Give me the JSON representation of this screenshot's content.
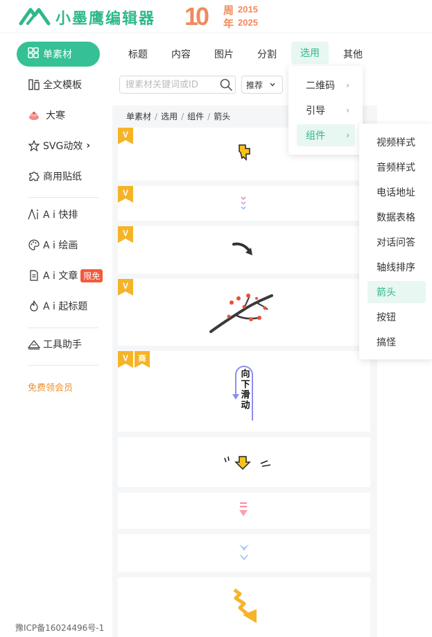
{
  "brand": {
    "name": "小墨鹰编辑器",
    "anniversary": {
      "number": "10",
      "char1": "周",
      "char2": "年",
      "year1": "2015",
      "year2": "2025"
    }
  },
  "sidebar": {
    "active": {
      "label": "单素材",
      "icon": "grid-icon"
    },
    "items": [
      {
        "label": "全文模板",
        "icon": "template-icon"
      },
      {
        "label": "大寒",
        "icon": "festival-icon"
      },
      {
        "label": "SVG动效",
        "icon": "star-icon",
        "suffix": "›"
      },
      {
        "label": "商用贴纸",
        "icon": "puzzle-icon"
      },
      {
        "label": "A i 快排",
        "icon": "ai-layout-icon"
      },
      {
        "label": "A i 绘画",
        "icon": "palette-icon"
      },
      {
        "label": "A i 文章",
        "icon": "document-icon",
        "badge": "限免"
      },
      {
        "label": "A i 起标题",
        "icon": "flame-icon"
      },
      {
        "label": "工具助手",
        "icon": "tools-icon"
      }
    ],
    "vip_link": "免费领会员",
    "icp": "豫ICP备16024496号-1"
  },
  "topnav": {
    "tabs": [
      "标题",
      "内容",
      "图片",
      "分割",
      "选用",
      "其他"
    ],
    "active_index": 4
  },
  "search": {
    "placeholder": "搜素材关键词或ID",
    "sort_value": "推荐"
  },
  "breadcrumb": [
    "单素材",
    "选用",
    "组件",
    "箭头"
  ],
  "dropdown1": {
    "items": [
      "二维码",
      "引导",
      "组件"
    ],
    "active_index": 2
  },
  "dropdown2": {
    "items": [
      "视频样式",
      "音频样式",
      "电话地址",
      "数据表格",
      "对话问答",
      "轴线排序",
      "箭头",
      "按钮",
      "搞怪"
    ],
    "active_index": 6
  },
  "cards": [
    {
      "tags": [
        "V"
      ],
      "content": "pointing-hand-icon"
    },
    {
      "tags": [
        "V"
      ],
      "content": "dotted-arrow-icon"
    },
    {
      "tags": [
        "V"
      ],
      "content": "curved-arrow-icon"
    },
    {
      "tags": [
        "V"
      ],
      "content": "plum-branch-image"
    },
    {
      "tags": [
        "V",
        "商"
      ],
      "content": "scroll-down-label",
      "text": "向下滑动"
    },
    {
      "tags": [],
      "content": "bouncing-arrow-icon"
    },
    {
      "tags": [],
      "content": "pink-arrow-icon"
    },
    {
      "tags": [],
      "content": "blue-chevron-icon"
    },
    {
      "tags": [],
      "content": "zigzag-arrow-icon"
    }
  ],
  "colors": {
    "brand": "#2eb88a",
    "active_bg": "#36c095",
    "vip": "#f0902a",
    "badge": "#f25a3c",
    "tag_gold": "#f5b428"
  }
}
